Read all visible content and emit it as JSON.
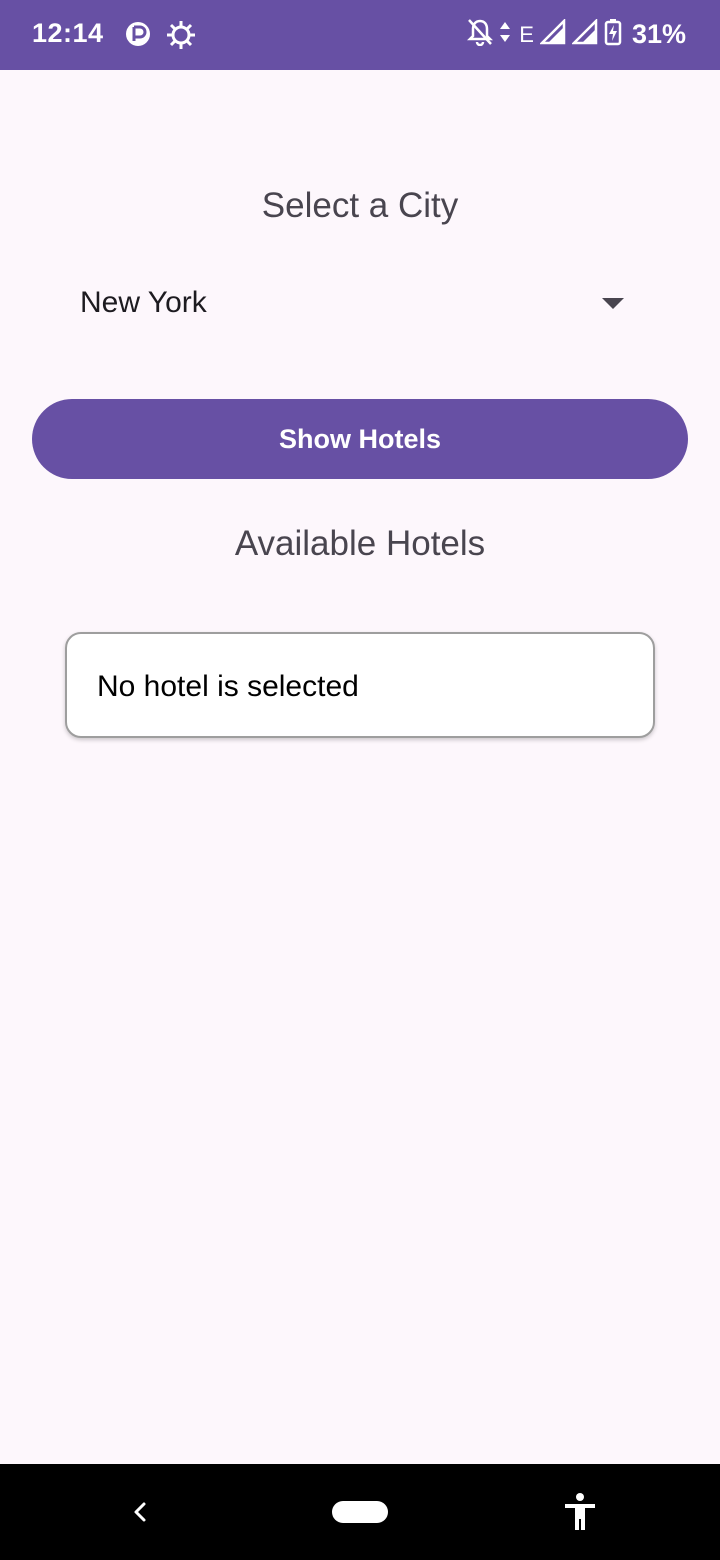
{
  "status_bar": {
    "time": "12:14",
    "network": "E",
    "battery": "31%",
    "left_icons": [
      "data-saver-icon",
      "brightness-icon"
    ],
    "right_icons": [
      "notifications-off-icon",
      "data-arrows-icon",
      "signal-icon",
      "signal-icon",
      "battery-charging-icon"
    ]
  },
  "main": {
    "title": "Select a City",
    "city_select": {
      "selected_value": "New York"
    },
    "show_button_label": "Show Hotels",
    "section_title": "Available Hotels",
    "hotel_card_text": "No hotel is selected"
  },
  "nav_bar": {
    "icons": [
      "back-icon",
      "home-pill",
      "accessibility-icon"
    ]
  },
  "colors": {
    "primary": "#6750a4",
    "background": "#fdf7fc",
    "nav_background": "#000000"
  }
}
